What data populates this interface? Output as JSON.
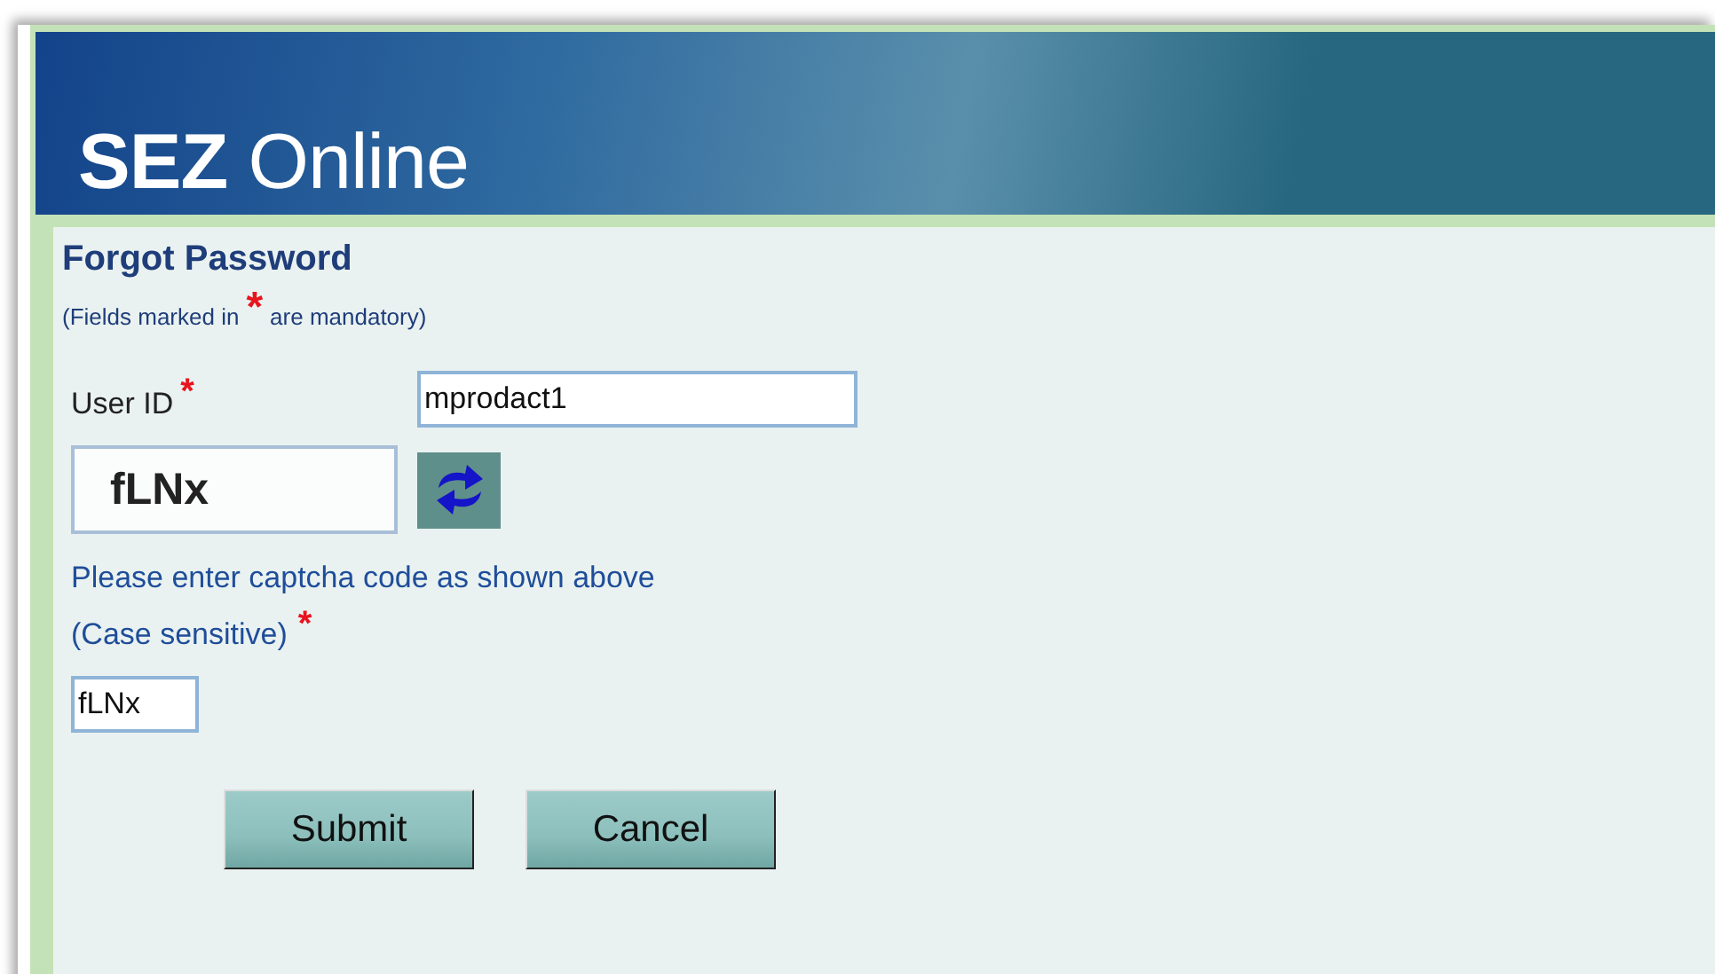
{
  "header": {
    "brand_bold": "SEZ",
    "brand_rest": "Online"
  },
  "form": {
    "title": "Forgot Password",
    "note": {
      "before": "(Fields marked in",
      "mark": "*",
      "after": "are mandatory)"
    },
    "user_id": {
      "label": "User ID",
      "mark": "*",
      "value": "mprodact1"
    },
    "captcha": {
      "code": "fLNx",
      "instruction": "Please enter captcha code as shown above",
      "case_note": "(Case sensitive)",
      "mark": "*",
      "value": "fLNx"
    },
    "buttons": [
      "Submit",
      "Cancel"
    ]
  }
}
